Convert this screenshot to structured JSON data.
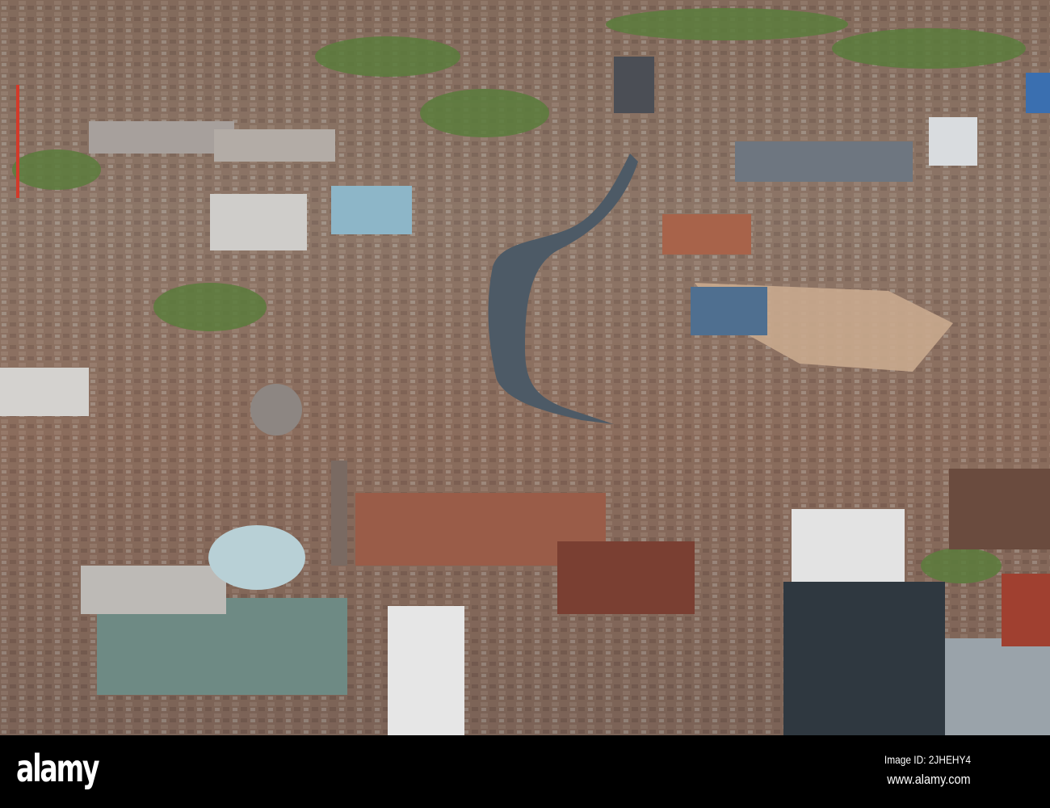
{
  "photo": {
    "subject": "aerial city view with river",
    "colors": {
      "river": "#4d5a66",
      "brick": "#8a5a48",
      "roof": "#b9b2a8",
      "green": "#4f7a3a",
      "glass": "#3d4d58"
    }
  },
  "watermark": {
    "logo": "alamy",
    "image_id": "Image ID: 2JHEHY4",
    "website": "www.alamy.com"
  }
}
